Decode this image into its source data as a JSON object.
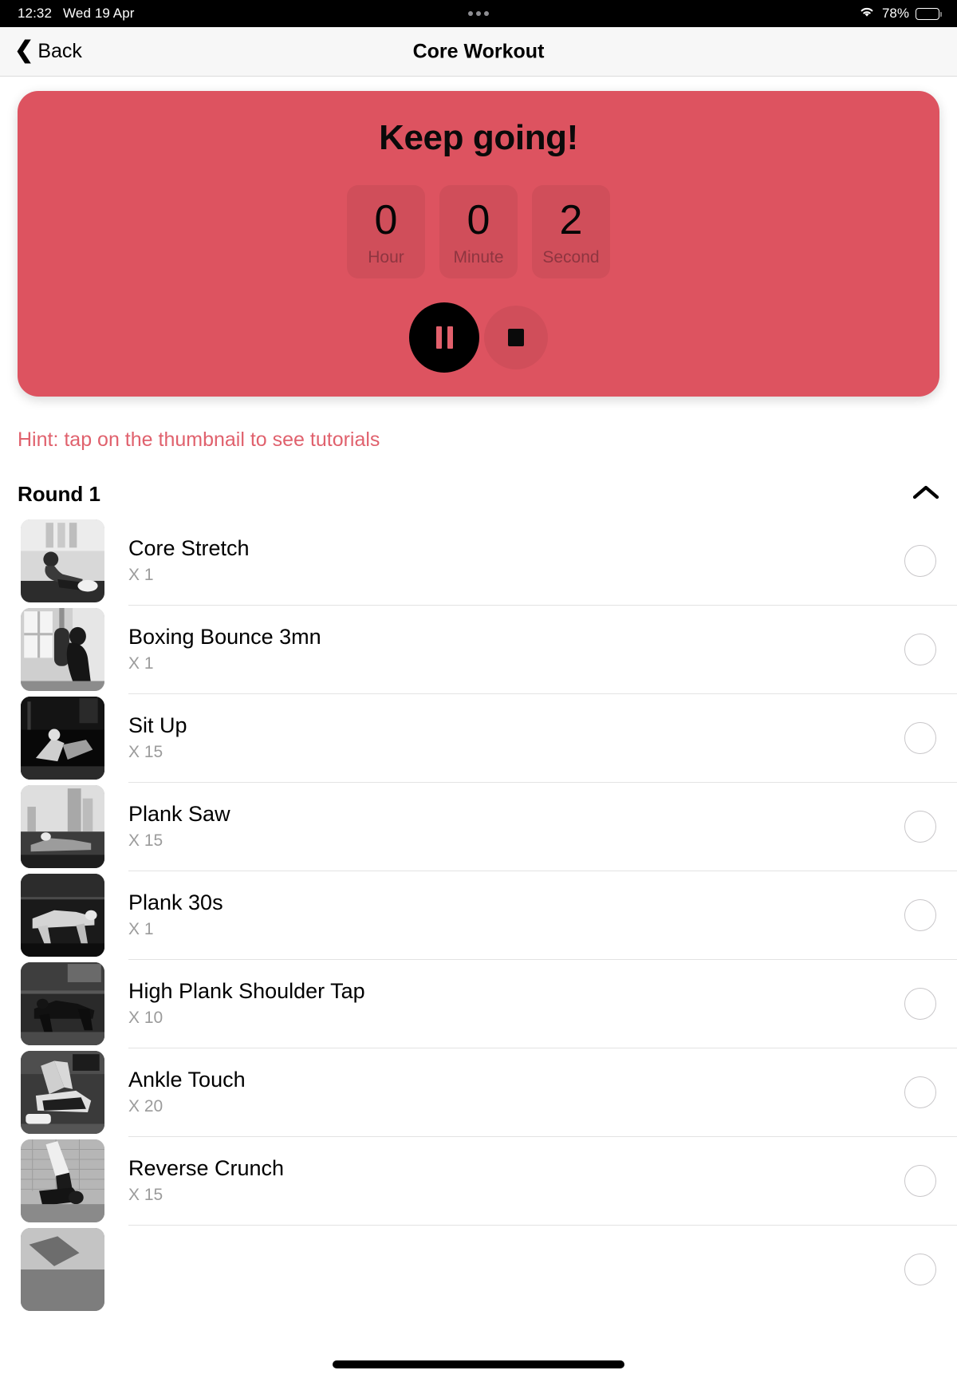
{
  "status_bar": {
    "time": "12:32",
    "date": "Wed 19 Apr",
    "battery_percent": "78%",
    "wifi_icon": "wifi-icon",
    "battery_icon": "battery-icon",
    "dots_icon": "recording-dots-icon"
  },
  "nav": {
    "back_label": "Back",
    "back_icon": "chevron-left-icon",
    "title": "Core Workout"
  },
  "timer": {
    "heading": "Keep going!",
    "units": [
      {
        "value": "0",
        "label": "Hour"
      },
      {
        "value": "0",
        "label": "Minute"
      },
      {
        "value": "2",
        "label": "Second"
      }
    ],
    "pause_icon": "pause-icon",
    "stop_icon": "stop-icon",
    "card_color": "#dd5360",
    "pause_button_color": "#000000",
    "pause_glyph_color": "#e2606c"
  },
  "hint": {
    "text": "Hint: tap on the thumbnail to see tutorials",
    "color": "#e0616d"
  },
  "round": {
    "title": "Round 1",
    "collapse_icon": "chevron-up-icon"
  },
  "exercises": [
    {
      "name": "Core Stretch",
      "reps": "X 1",
      "thumb": "seated-stretch-photo"
    },
    {
      "name": "Boxing Bounce 3mn",
      "reps": "X 1",
      "thumb": "boxing-bag-photo"
    },
    {
      "name": "Sit Up",
      "reps": "X 15",
      "thumb": "sit-up-photo"
    },
    {
      "name": "Plank Saw",
      "reps": "X 15",
      "thumb": "plank-saw-photo"
    },
    {
      "name": "Plank 30s",
      "reps": "X 1",
      "thumb": "plank-photo"
    },
    {
      "name": "High Plank Shoulder Tap",
      "reps": "X 10",
      "thumb": "shoulder-tap-photo"
    },
    {
      "name": "Ankle Touch",
      "reps": "X 20",
      "thumb": "ankle-touch-photo"
    },
    {
      "name": "Reverse Crunch",
      "reps": "X 15",
      "thumb": "reverse-crunch-photo"
    },
    {
      "name": "",
      "reps": "",
      "thumb": "partial-photo"
    }
  ]
}
